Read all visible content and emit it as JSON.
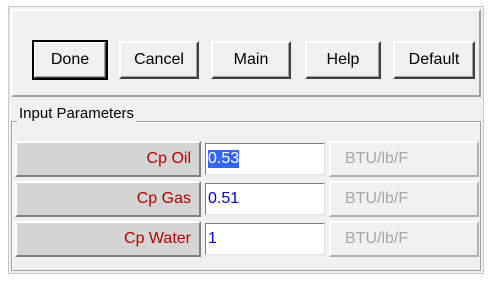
{
  "toolbar": {
    "done_label": "Done",
    "cancel_label": "Cancel",
    "main_label": "Main",
    "help_label": "Help",
    "default_label": "Default"
  },
  "input_parameters": {
    "title": "Input Parameters",
    "rows": [
      {
        "label": "Cp Oil",
        "value": "0.53",
        "unit": "BTU/lb/F",
        "selected": true
      },
      {
        "label": "Cp Gas",
        "value": "0.51",
        "unit": "BTU/lb/F",
        "selected": false
      },
      {
        "label": "Cp Water",
        "value": "1",
        "unit": "BTU/lb/F",
        "selected": false
      }
    ]
  },
  "colors": {
    "label_text": "#b40000",
    "value_text": "#0000cc",
    "selection": "#3366ff",
    "unit_text": "#a8a8a8",
    "panel_bg": "#f0f0f0",
    "label_bg": "#d4d4d4"
  }
}
